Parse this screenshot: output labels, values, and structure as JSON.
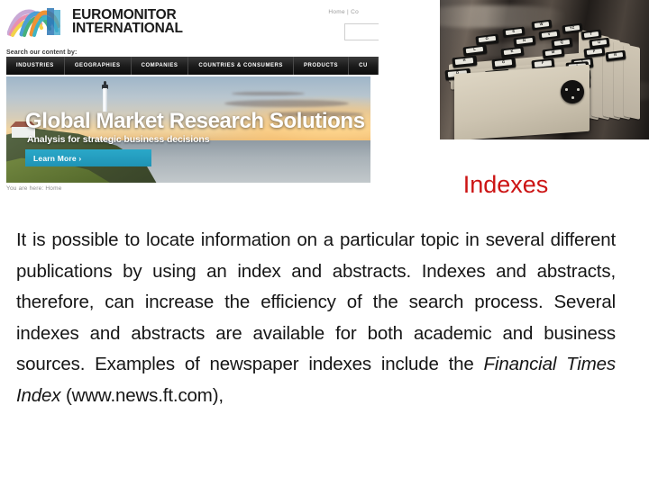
{
  "slide": {
    "title": "Indexes",
    "title_color": "#cc1414",
    "body_lead": "It is possible to locate information on a particular topic in several different publications by using an index and abstracts. Indexes and abstracts, therefore, can increase the efficiency of the search process. Several indexes and abstracts are available for both academic and business sources. Examples of newspaper indexes include the ",
    "body_italic": "Financial Times Index",
    "body_tail": " (www.news.ft.com),"
  },
  "website": {
    "logo": {
      "line1": "EUROMONITOR",
      "line2": "INTERNATIONAL",
      "colors": [
        "#b48fc4",
        "#e58aa8",
        "#4aa3d8",
        "#59b86a",
        "#f0a13a",
        "#f2d23c",
        "#39a8c0"
      ]
    },
    "utility_links": "Home | Co",
    "search_label": "Search our content by:",
    "nav_items": [
      "INDUSTRIES",
      "GEOGRAPHIES",
      "COMPANIES",
      "COUNTRIES & CONSUMERS",
      "PRODUCTS",
      "CU"
    ],
    "banner": {
      "title": "Global Market Research Solutions",
      "subtitle": "Analysis for strategic business decisions",
      "cta": "Learn More ›",
      "cta_color": "#1f93b5"
    },
    "breadcrumb": "You are here: Home"
  },
  "photo": {
    "caption": "index-card-dividers-photo",
    "tab_labels": [
      "A",
      "B",
      "C",
      "D",
      "E",
      "F",
      "G",
      "H",
      "I",
      "J",
      "K",
      "L",
      "M",
      "N",
      "O",
      "P",
      "Q",
      "R",
      "S",
      "T",
      "U",
      "V",
      "W",
      "X",
      "YZ"
    ]
  }
}
